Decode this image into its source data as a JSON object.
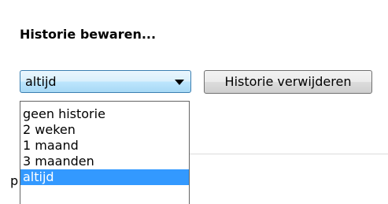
{
  "history": {
    "title": "Historie bewaren...",
    "select": {
      "value": "altijd",
      "options": [
        "geen historie",
        "2 weken",
        "1 maand",
        "3 maanden",
        "altijd"
      ],
      "selected_index": 4
    },
    "clear_button_label": "Historie verwijderen"
  },
  "colors": {
    "selection_highlight": "#3399ff",
    "select_border": "#3c7fb1"
  },
  "icons": {
    "dropdown_arrow": "chevron-down-icon"
  },
  "partial_text": "p"
}
